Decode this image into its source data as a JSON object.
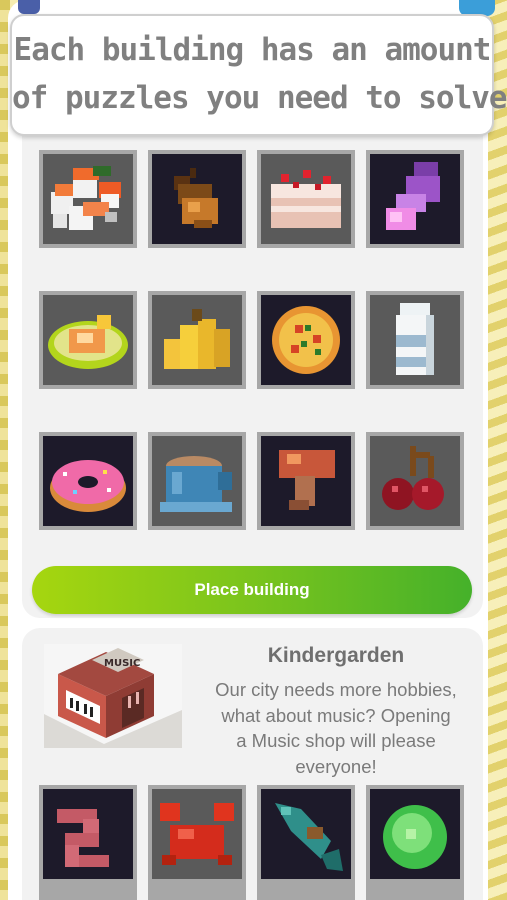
{
  "caption": {
    "line1": "Each building has an amount",
    "line2": "of puzzles you need to solve"
  },
  "puzzles": [
    {
      "name": "sushi",
      "bg": "gray",
      "icon": "sushi-icon"
    },
    {
      "name": "acorn",
      "bg": "dark",
      "icon": "acorn-icon"
    },
    {
      "name": "cake",
      "bg": "gray",
      "icon": "cake-icon"
    },
    {
      "name": "grape-juice",
      "bg": "dark",
      "icon": "juice-icon"
    },
    {
      "name": "omelette",
      "bg": "gray",
      "icon": "omelette-icon"
    },
    {
      "name": "bananas",
      "bg": "gray",
      "icon": "banana-icon"
    },
    {
      "name": "pizza",
      "bg": "dark",
      "icon": "pizza-icon"
    },
    {
      "name": "milk",
      "bg": "gray",
      "icon": "milk-icon"
    },
    {
      "name": "donut",
      "bg": "dark",
      "icon": "donut-icon"
    },
    {
      "name": "coffee",
      "bg": "gray",
      "icon": "coffee-icon"
    },
    {
      "name": "mushroom",
      "bg": "dark",
      "icon": "mushroom-icon"
    },
    {
      "name": "cherries",
      "bg": "gray",
      "icon": "cherry-icon"
    }
  ],
  "place_button": {
    "label": "Place building"
  },
  "next_building": {
    "title": "Kindergarden",
    "description_lines": [
      "Our city needs more hobbies,",
      "what about music? Opening",
      "a Music shop will please",
      "everyone!"
    ],
    "image_sign": "MUSIC",
    "puzzles": [
      {
        "name": "worm",
        "bg": "dark",
        "icon": "worm-icon"
      },
      {
        "name": "crab",
        "bg": "gray",
        "icon": "crab-icon"
      },
      {
        "name": "fish",
        "bg": "dark",
        "icon": "fish-icon"
      },
      {
        "name": "cabbage",
        "bg": "dark",
        "icon": "cabbage-icon"
      }
    ]
  },
  "colors": {
    "button_start": "#a6d60f",
    "button_end": "#45b12a",
    "tile_frame": "#a7a7a7",
    "tile_dark": "#1d1a2a",
    "tile_gray": "#5a5a5a"
  }
}
